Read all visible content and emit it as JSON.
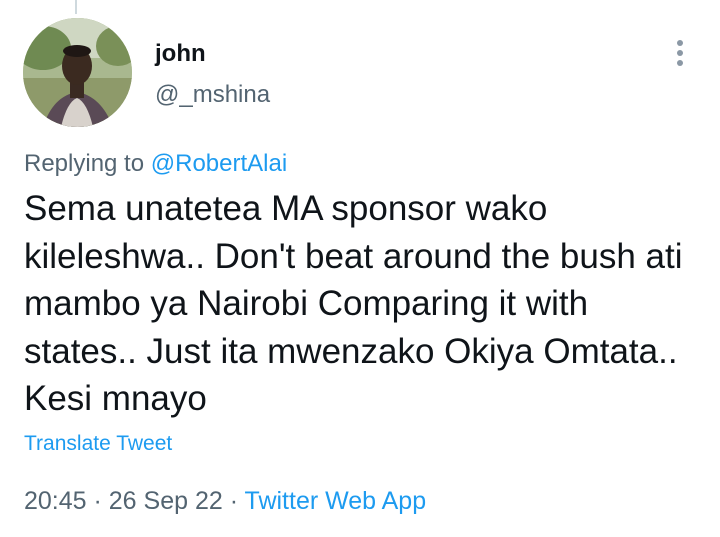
{
  "tweet": {
    "display_name": "john",
    "handle": "@_mshina",
    "replying_prefix": "Replying to ",
    "replying_to": "@RobertAlai",
    "text": "Sema unatetea MA sponsor wako kileleshwa.. Don't beat around the bush ati mambo ya Nairobi Comparing it with states.. Just ita mwenzako Okiya Omtata.. Kesi mnayo",
    "translate_label": "Translate Tweet",
    "time": "20:45",
    "date": "26 Sep 22",
    "separator": " · ",
    "source": "Twitter Web App"
  },
  "icons": {
    "more": "more-vertical-icon",
    "avatar": "user-avatar"
  },
  "colors": {
    "link": "#1d9bf0",
    "secondary": "#536471",
    "text": "#0f1419"
  }
}
